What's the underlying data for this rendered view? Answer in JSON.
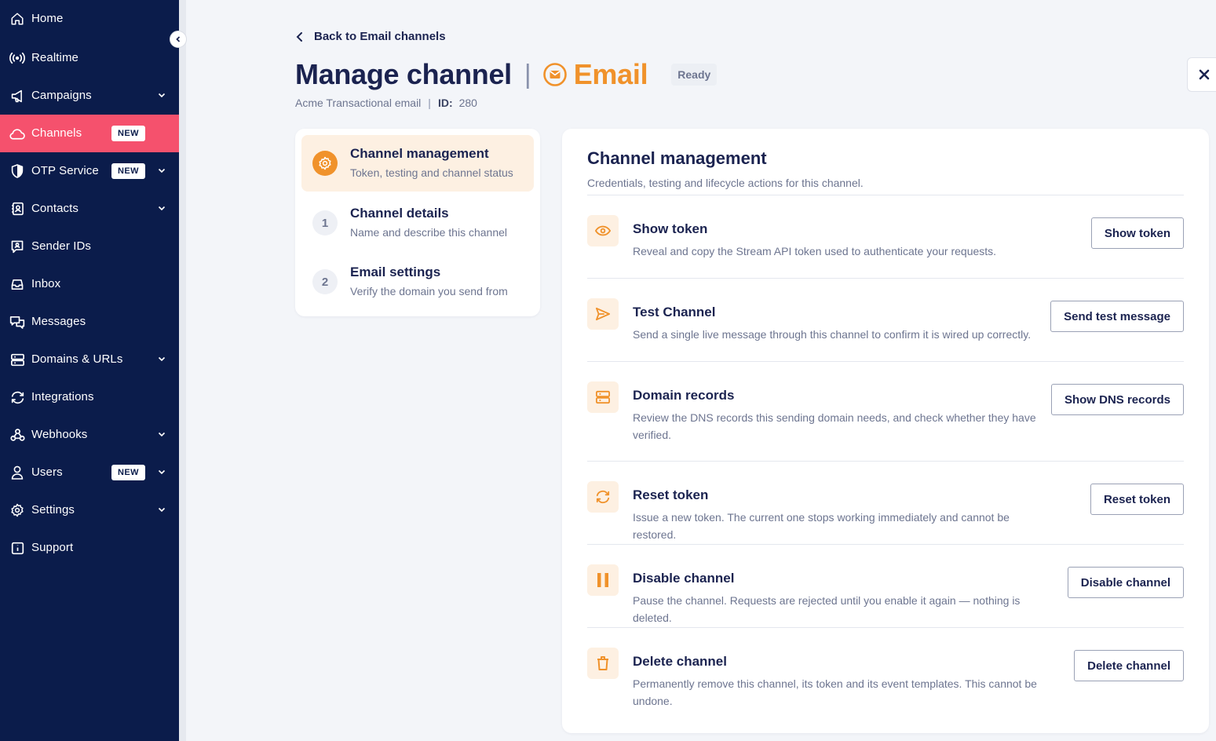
{
  "sidebar": {
    "items": [
      {
        "label": "Home",
        "icon": "home-icon"
      },
      {
        "label": "Realtime",
        "icon": "broadcast-icon"
      },
      {
        "label": "Campaigns",
        "icon": "megaphone-icon"
      },
      {
        "label": "Channels",
        "icon": "cloud-icon",
        "badge": "NEW"
      },
      {
        "label": "OTP Service",
        "icon": "shield-icon",
        "badge": "NEW"
      },
      {
        "label": "Contacts",
        "icon": "contacts-icon"
      },
      {
        "label": "Sender IDs",
        "icon": "sender-id-icon"
      },
      {
        "label": "Inbox",
        "icon": "inbox-icon"
      },
      {
        "label": "Messages",
        "icon": "messages-icon"
      },
      {
        "label": "Domains & URLs",
        "icon": "server-icon"
      },
      {
        "label": "Integrations",
        "icon": "sync-icon"
      },
      {
        "label": "Webhooks",
        "icon": "webhook-icon"
      },
      {
        "label": "Users",
        "icon": "user-icon",
        "badge": "NEW"
      },
      {
        "label": "Settings",
        "icon": "gear-icon"
      },
      {
        "label": "Support",
        "icon": "info-icon"
      }
    ]
  },
  "header": {
    "back_label": "Back to Email channels",
    "title": "Manage channel",
    "separator": "|",
    "channel_type": "Email",
    "status": "Ready",
    "channel_name": "Acme Transactional email",
    "id_label": "ID:",
    "id_value": "280"
  },
  "steps": [
    {
      "marker": "",
      "title": "Channel management",
      "desc": "Token, testing and channel status"
    },
    {
      "marker": "1",
      "title": "Channel details",
      "desc": "Name and describe this channel"
    },
    {
      "marker": "2",
      "title": "Email settings",
      "desc": "Verify the domain you send from"
    }
  ],
  "main": {
    "title": "Channel management",
    "subtitle": "Credentials, testing and lifecycle actions for this channel.",
    "actions": [
      {
        "icon": "eye-icon",
        "title": "Show token",
        "desc": "Reveal and copy the Stream API token used to authenticate your requests.",
        "button": "Show token"
      },
      {
        "icon": "send-icon",
        "title": "Test Channel",
        "desc": "Send a single live message through this channel to confirm it is wired up correctly.",
        "button": "Send test message"
      },
      {
        "icon": "server-icon",
        "title": "Domain records",
        "desc": "Review the DNS records this sending domain needs, and check whether they have verified.",
        "button": "Show DNS records"
      },
      {
        "icon": "refresh-icon",
        "title": "Reset token",
        "desc": "Issue a new token. The current one stops working immediately and cannot be restored.",
        "button": "Reset token"
      },
      {
        "icon": "pause-icon",
        "title": "Disable channel",
        "desc": "Pause the channel. Requests are rejected until you enable it again — nothing is deleted.",
        "button": "Disable channel"
      },
      {
        "icon": "trash-icon",
        "title": "Delete channel",
        "desc": "Permanently remove this channel, its token and its event templates. This cannot be undone.",
        "button": "Delete channel"
      }
    ]
  },
  "colors": {
    "sidebar_bg": "#0b1c4b",
    "active_nav": "#f5516d",
    "accent_orange": "#f0922b",
    "text_dark": "#1b2350",
    "text_muted": "#6d7590"
  }
}
